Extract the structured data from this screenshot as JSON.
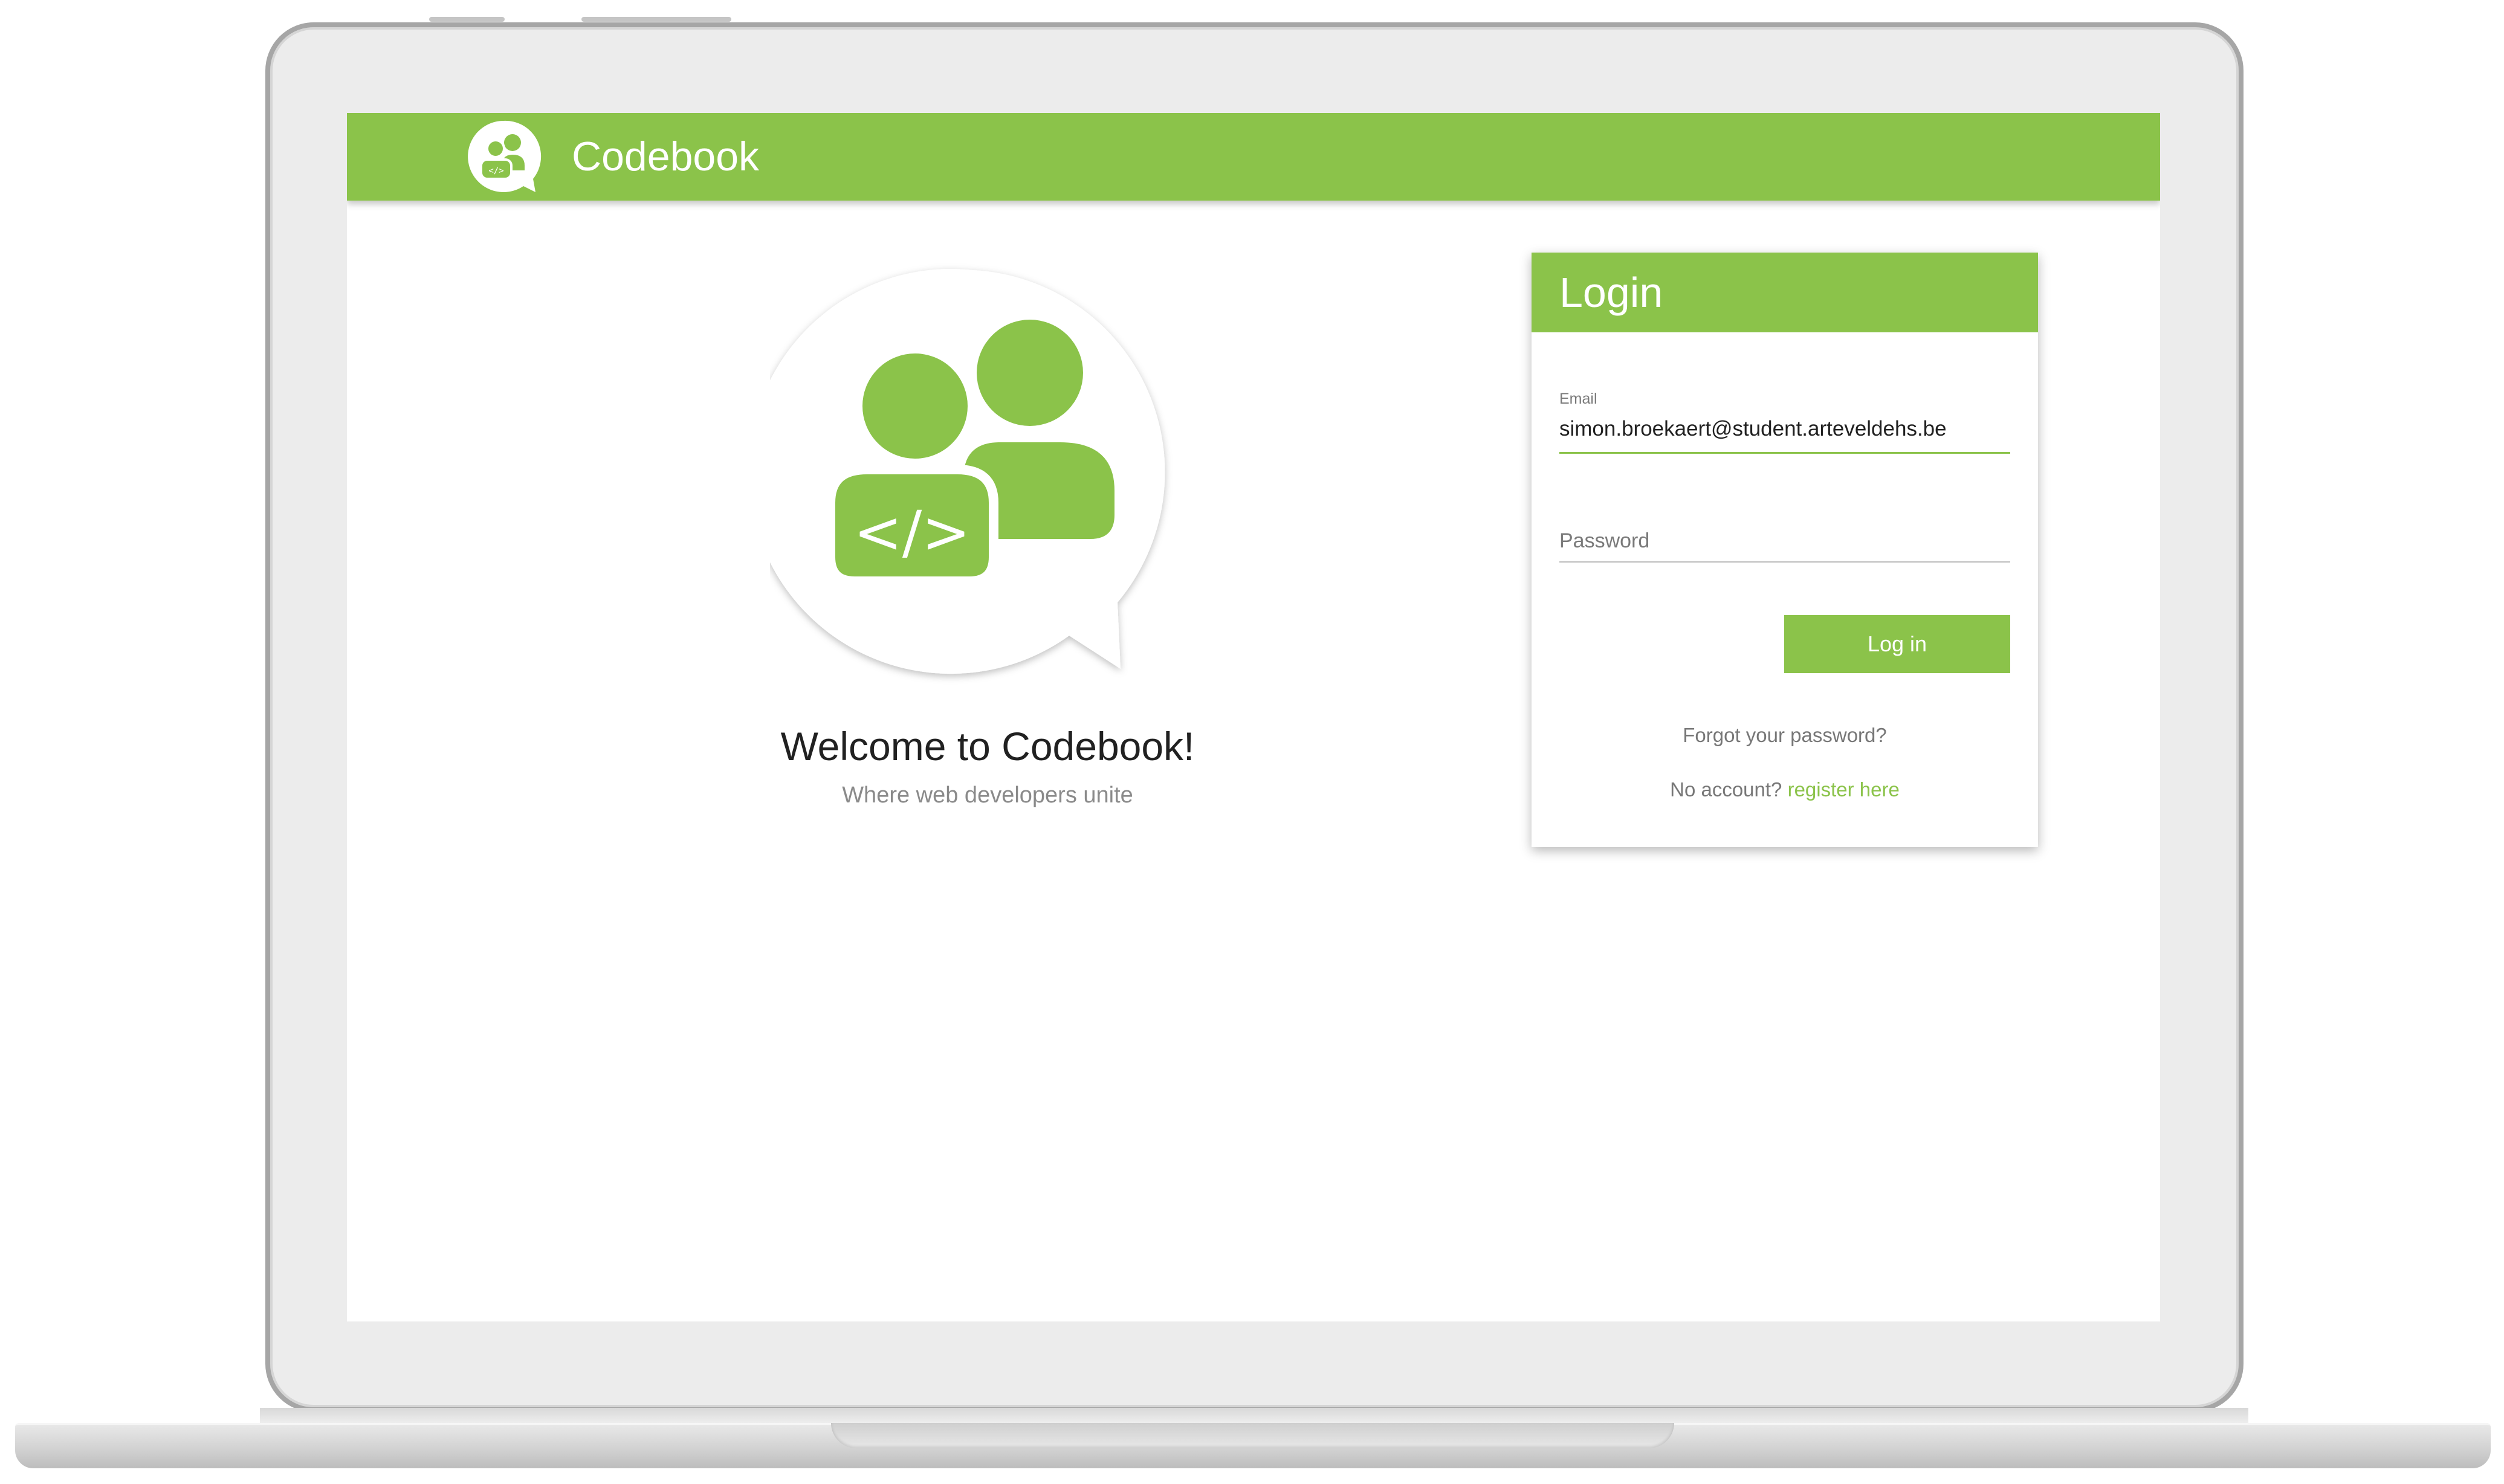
{
  "header": {
    "app_name": "Codebook",
    "logo_icon": "codebook-logo-icon"
  },
  "hero": {
    "logo_icon": "codebook-users-chat-icon",
    "code_glyph": "</>",
    "title": "Welcome to Codebook!",
    "tagline": "Where web developers unite"
  },
  "login": {
    "title": "Login",
    "email_label": "Email",
    "email_value": "simon.broekaert@student.arteveldehs.be",
    "password_placeholder": "Password",
    "submit_label": "Log in",
    "forgot_link": "Forgot your password?",
    "no_account_text": "No account?",
    "register_link": "register here"
  },
  "colors": {
    "accent": "#8bc34a",
    "text": "#212121",
    "muted": "#7a7a7a"
  }
}
